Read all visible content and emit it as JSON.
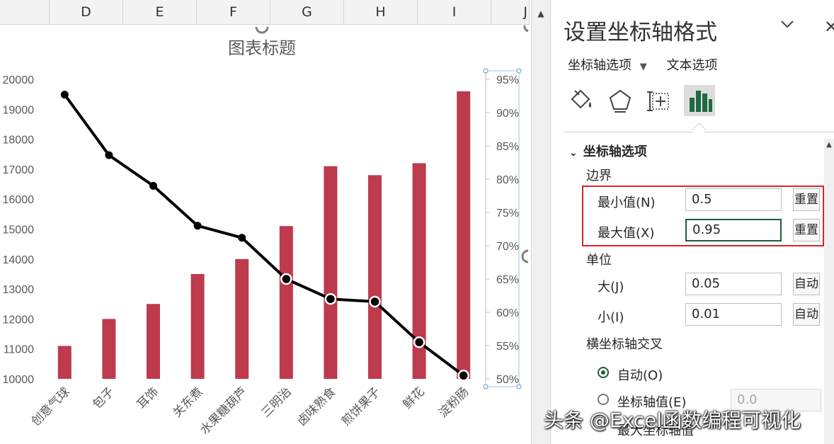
{
  "spreadsheet": {
    "columns": [
      "D",
      "E",
      "F",
      "G",
      "H",
      "I",
      "J"
    ]
  },
  "chart_data": {
    "type": "bar",
    "title": "图表标题",
    "categories": [
      "创意气球",
      "包子",
      "耳饰",
      "关东煮",
      "水果糖葫芦",
      "三明治",
      "卤味熟食",
      "煎饼果子",
      "鲜花",
      "淀粉肠"
    ],
    "series": [
      {
        "type": "bar",
        "axis": "primary",
        "values": [
          11100,
          12000,
          12500,
          13500,
          14000,
          15100,
          17100,
          16800,
          17200,
          19600
        ],
        "color": "#be3a4d"
      },
      {
        "type": "line",
        "axis": "secondary",
        "values": [
          0.927,
          0.836,
          0.79,
          0.73,
          0.712,
          0.65,
          0.62,
          0.616,
          0.555,
          0.505
        ],
        "color": "#000000"
      }
    ],
    "ylim": [
      10000,
      20000
    ],
    "yticks": [
      "10000",
      "11000",
      "12000",
      "13000",
      "14000",
      "15000",
      "16000",
      "17000",
      "18000",
      "19000",
      "20000"
    ],
    "y2lim": [
      0.5,
      0.95
    ],
    "y2ticks": [
      "50%",
      "55%",
      "60%",
      "65%",
      "70%",
      "75%",
      "80%",
      "85%",
      "90%",
      "95%"
    ],
    "grid": false
  },
  "panel": {
    "title": "设置坐标轴格式",
    "tabs": [
      "坐标轴选项",
      "文本选项"
    ],
    "section": "坐标轴选项",
    "bounds_label": "边界",
    "min_label": "最小值(N)",
    "min_value": "0.5",
    "max_label": "最大值(X)",
    "max_value": "0.95",
    "reset_label": "重置",
    "units_label": "单位",
    "major_label": "大(J)",
    "major_value": "0.05",
    "minor_label": "小(I)",
    "minor_value": "0.01",
    "auto_label": "自动",
    "cross_label": "横坐标轴交叉",
    "auto_option": "自动(O)",
    "axis_value_option": "坐标轴值(E)",
    "axis_value": "0.0",
    "max_axis_value_option": "最大坐标轴值"
  },
  "watermark": "头条 @Excel函数编程可视化"
}
